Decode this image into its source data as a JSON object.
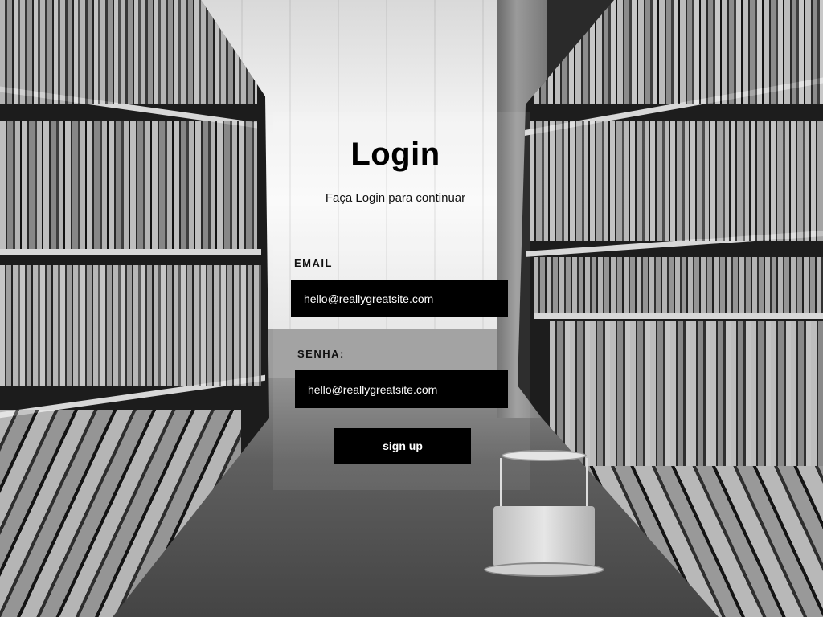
{
  "login": {
    "title": "Login",
    "subtitle": "Faça Login para continuar",
    "email_label": "EMAIL",
    "email_value": "hello@reallygreatsite.com",
    "password_label": "SENHA:",
    "password_value": "hello@reallygreatsite.com",
    "submit_label": "sign up"
  },
  "colors": {
    "field_background": "#000000",
    "field_text": "#ffffff",
    "button_background": "#000000",
    "button_text": "#ffffff",
    "heading_text": "#000000"
  },
  "background": {
    "description_icon": "library-bookshelves-photo"
  }
}
